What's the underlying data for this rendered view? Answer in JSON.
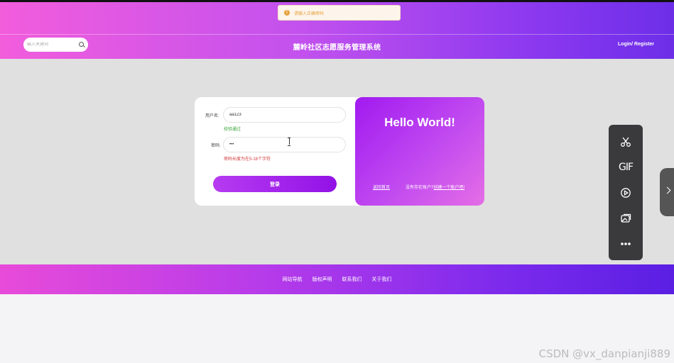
{
  "toast": {
    "icon": "warning-icon",
    "text": "请输入正确密码",
    "color": "#e6a23c"
  },
  "header": {
    "search_placeholder": "输入关键词",
    "title": "麓岭社区志愿服务管理系统",
    "login": "Login",
    "separator": "/",
    "register": "Register"
  },
  "login_form": {
    "username_label": "用户名:",
    "username_value": "aa123",
    "username_hint": "校验通过",
    "password_label": "密码:",
    "password_value": "•••",
    "password_hint": "密码长度为在5-16个字符",
    "submit_label": "登录"
  },
  "welcome": {
    "title": "Hello World!",
    "back_home": "返回首页",
    "no_account": "没有存在账户?",
    "create_account": "创建一个账户吧!"
  },
  "toolbox": {
    "items": [
      "scissors-icon",
      "GIF",
      "screen-record-icon",
      "screenshot-icon",
      "more-icon"
    ]
  },
  "footer": {
    "links": [
      "网站导航",
      "版权声明",
      "联系我们",
      "关于我们"
    ]
  },
  "watermark": "CSDN @vx_danpianji889",
  "colors": {
    "header_start": "#f25ddc",
    "header_end": "#6d2ee8",
    "panel_purple": "#a11af0",
    "success": "#3aa33a",
    "error": "#d23b3b"
  }
}
